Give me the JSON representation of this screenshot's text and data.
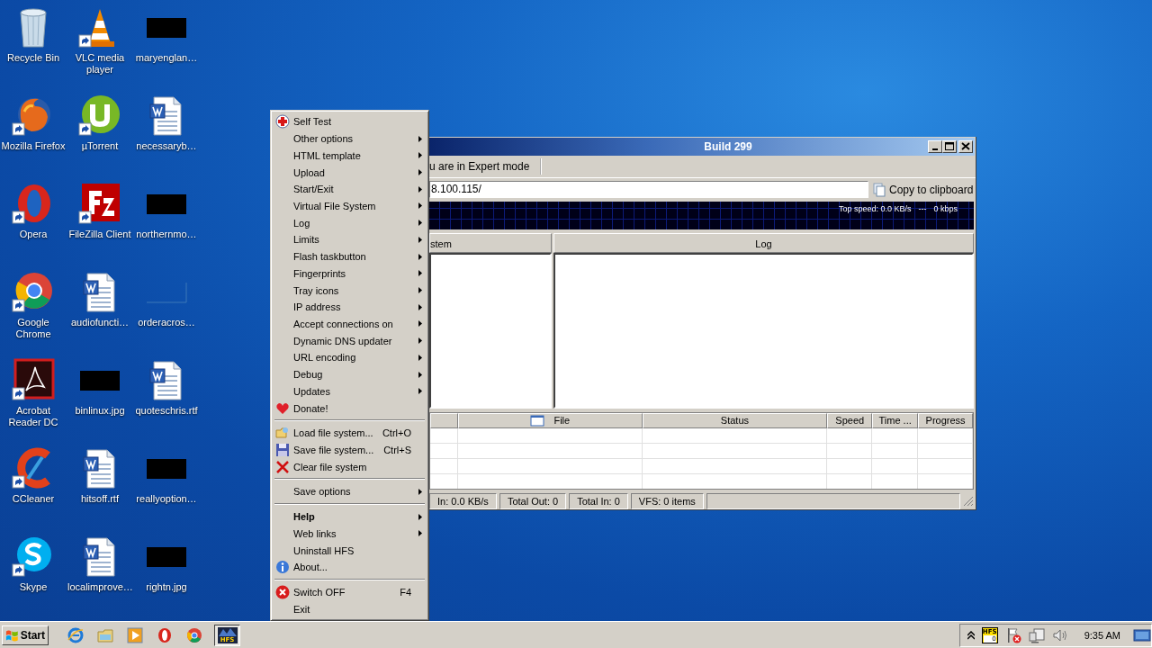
{
  "desktop_icons": [
    {
      "label": "Recycle Bin"
    },
    {
      "label": "VLC media player"
    },
    {
      "label": "maryenglan…"
    },
    {
      "label": "Mozilla Firefox"
    },
    {
      "label": "µTorrent"
    },
    {
      "label": "necessaryb…"
    },
    {
      "label": "Opera"
    },
    {
      "label": "FileZilla Client"
    },
    {
      "label": "northernmo…"
    },
    {
      "label": "Google Chrome"
    },
    {
      "label": "audiofuncti…"
    },
    {
      "label": "orderacros…"
    },
    {
      "label": "Acrobat Reader DC"
    },
    {
      "label": "binlinux.jpg"
    },
    {
      "label": "quoteschris.rtf"
    },
    {
      "label": "CCleaner"
    },
    {
      "label": "hitsoff.rtf"
    },
    {
      "label": "reallyoption…"
    },
    {
      "label": "Skype"
    },
    {
      "label": "localimprove…"
    },
    {
      "label": "rightn.jpg"
    }
  ],
  "hfs_window": {
    "title": "Build 299",
    "mode_text": "u are in Expert mode",
    "url": "8.100.115/",
    "copy_button": "Copy to clipboard",
    "graph": {
      "top_speed": "Top speed: 0.0 KB/s",
      "separator": "---",
      "rate": "0 kbps"
    },
    "panels": [
      "stem",
      "Log"
    ],
    "transfer_columns": [
      {
        "kind": "blank"
      },
      {
        "kind": "file",
        "label": "File"
      },
      {
        "kind": "text",
        "label": "Status"
      },
      {
        "kind": "text",
        "label": "Speed"
      },
      {
        "kind": "text",
        "label": "Time ..."
      },
      {
        "kind": "text",
        "label": "Progress"
      }
    ],
    "status_bar": [
      "In: 0.0 KB/s",
      "Total Out: 0",
      "Total In: 0",
      "VFS: 0 items"
    ]
  },
  "context_menu": {
    "items": [
      {
        "kind": "item",
        "label": "Self Test",
        "submenu": false,
        "default": false
      },
      {
        "kind": "item",
        "label": "Other options",
        "submenu": true,
        "default": false
      },
      {
        "kind": "item",
        "label": "HTML template",
        "submenu": true,
        "default": false
      },
      {
        "kind": "item",
        "label": "Upload",
        "submenu": true,
        "default": false
      },
      {
        "kind": "item",
        "label": "Start/Exit",
        "submenu": true,
        "default": false
      },
      {
        "kind": "item",
        "label": "Virtual File System",
        "submenu": true,
        "default": false
      },
      {
        "kind": "item",
        "label": "Log",
        "submenu": true,
        "default": false
      },
      {
        "kind": "item",
        "label": "Limits",
        "submenu": true,
        "default": false
      },
      {
        "kind": "item",
        "label": "Flash taskbutton",
        "submenu": true,
        "default": false
      },
      {
        "kind": "item",
        "label": "Fingerprints",
        "submenu": true,
        "default": false
      },
      {
        "kind": "item",
        "label": "Tray icons",
        "submenu": true,
        "default": false
      },
      {
        "kind": "item",
        "label": "IP address",
        "submenu": true,
        "default": false
      },
      {
        "kind": "item",
        "label": "Accept connections on",
        "submenu": true,
        "default": false
      },
      {
        "kind": "item",
        "label": "Dynamic DNS updater",
        "submenu": true,
        "default": false
      },
      {
        "kind": "item",
        "label": "URL encoding",
        "submenu": true,
        "default": false
      },
      {
        "kind": "item",
        "label": "Debug",
        "submenu": true,
        "default": false
      },
      {
        "kind": "item",
        "label": "Updates",
        "submenu": true,
        "default": false
      },
      {
        "kind": "item",
        "label": "Donate!",
        "submenu": false,
        "default": false
      },
      {
        "kind": "separator"
      },
      {
        "kind": "item",
        "label": "Load file system...",
        "shortcut": "Ctrl+O",
        "submenu": false,
        "default": false
      },
      {
        "kind": "item",
        "label": "Save file system...",
        "shortcut": "Ctrl+S",
        "submenu": false,
        "default": false
      },
      {
        "kind": "item",
        "label": "Clear file system",
        "submenu": false,
        "default": false
      },
      {
        "kind": "separator"
      },
      {
        "kind": "item",
        "label": "Save options",
        "submenu": true,
        "default": false
      },
      {
        "kind": "separator"
      },
      {
        "kind": "item",
        "label": "Help",
        "submenu": true,
        "default": true
      },
      {
        "kind": "item",
        "label": "Web links",
        "submenu": true,
        "default": false
      },
      {
        "kind": "item",
        "label": "Uninstall HFS",
        "submenu": false,
        "default": false
      },
      {
        "kind": "item",
        "label": "About...",
        "submenu": false,
        "default": false
      },
      {
        "kind": "separator"
      },
      {
        "kind": "item",
        "label": "Switch OFF",
        "shortcut": "F4",
        "submenu": false,
        "default": false
      },
      {
        "kind": "item",
        "label": "Exit",
        "submenu": false,
        "default": false
      }
    ]
  },
  "taskbar": {
    "start": "Start",
    "task_buttons": [
      {
        "badge": "HFS",
        "selected": true
      }
    ],
    "tray": {
      "hfs_badge": "HFS",
      "hfs_count": "0",
      "clock": "9:35 AM"
    }
  }
}
